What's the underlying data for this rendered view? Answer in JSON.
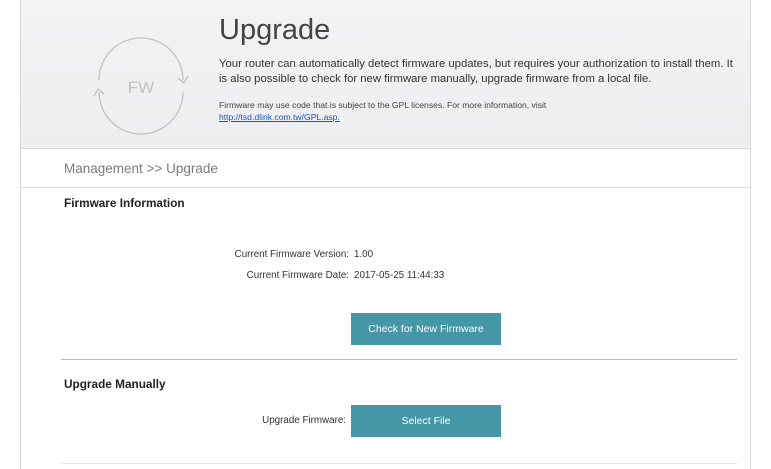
{
  "header": {
    "logo_text": "FW",
    "title": "Upgrade",
    "description": "Your router can automatically detect firmware updates, but requires your authorization to install them. It is also possible to check for new firmware manually, upgrade firmware from a local file.",
    "gpl_notice": "Firmware may use code that is subject to the GPL licenses. For more information, visit",
    "gpl_link": "http://tsd.dlink.com.tw/GPL.asp."
  },
  "breadcrumb": "Management >> Upgrade",
  "firmware_info": {
    "section_title": "Firmware Information",
    "version_label": "Current Firmware Version:",
    "version_value": "1.00",
    "date_label": "Current Firmware Date:",
    "date_value": "2017-05-25 11:44:33",
    "check_button": "Check for New Firmware"
  },
  "upgrade_manually": {
    "section_title": "Upgrade Manually",
    "upgrade_label": "Upgrade Firmware:",
    "select_button": "Select File"
  },
  "colors": {
    "button": "#4497a6",
    "link": "#1a55c7",
    "header_bg": "#eef0f1"
  },
  "icons": {
    "logo": "refresh-arrows-icon"
  }
}
